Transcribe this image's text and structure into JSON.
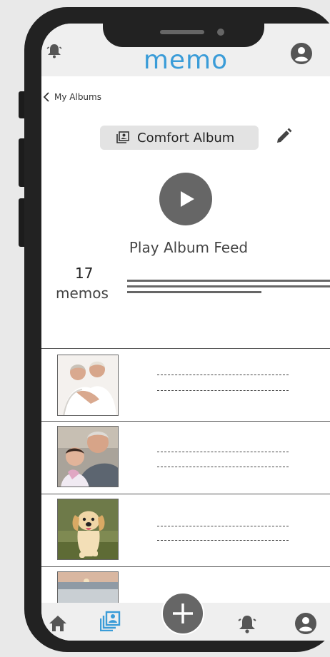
{
  "header": {
    "title": "memo",
    "bell_icon": "bell-icon",
    "avatar_icon": "account-circle-icon"
  },
  "nav_back": {
    "label": "My Albums"
  },
  "album": {
    "name": "Comfort Album",
    "edit_icon": "pencil-icon"
  },
  "feed": {
    "play_label": "Play Album Feed"
  },
  "stats": {
    "count": "17",
    "count_label": "memos"
  },
  "memos": [
    {
      "thumbnail": "elderly-couple-photo",
      "line1": "------------------------",
      "line2": "------------------------"
    },
    {
      "thumbnail": "grandfather-child-photo",
      "line1": "------------------------",
      "line2": "------------------------"
    },
    {
      "thumbnail": "puppy-photo",
      "line1": "------------------------",
      "line2": "------------------------"
    },
    {
      "thumbnail": "sunset-beach-photo"
    }
  ],
  "bottom_nav": {
    "items": [
      "home-icon",
      "albums-icon",
      "add-icon",
      "notifications-icon",
      "profile-icon"
    ],
    "active": "albums-icon"
  },
  "colors": {
    "brand": "#3a9cd8",
    "active_nav": "#3a9cd8",
    "icon_gray": "#555555",
    "chip_bg": "#e3e3e3"
  }
}
